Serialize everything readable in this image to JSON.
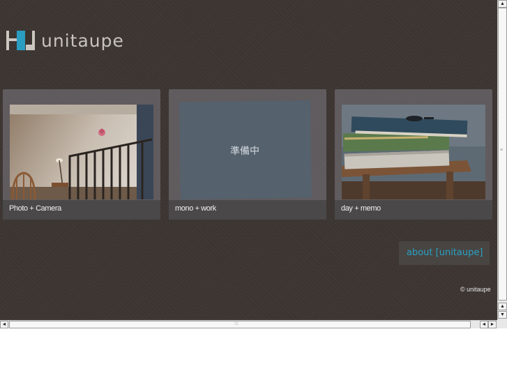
{
  "site": {
    "logo_text": "unitaupe",
    "logo_colors": [
      "#c9c4bd",
      "#2a9dc0",
      "#c9c4bd"
    ]
  },
  "cards": [
    {
      "caption": "Photo + Camera",
      "image": "room-staircase-photo"
    },
    {
      "caption": "mono + work",
      "placeholder": "準備中"
    },
    {
      "caption": "day + memo",
      "image": "stacked-books-photo"
    }
  ],
  "about": {
    "label": "about [unitaupe]",
    "color": "#2aa1c4"
  },
  "footer": {
    "copyright": "© unitaupe"
  },
  "scrollbars": {
    "up": "▲",
    "down": "▼",
    "left": "◄",
    "right": "►"
  }
}
